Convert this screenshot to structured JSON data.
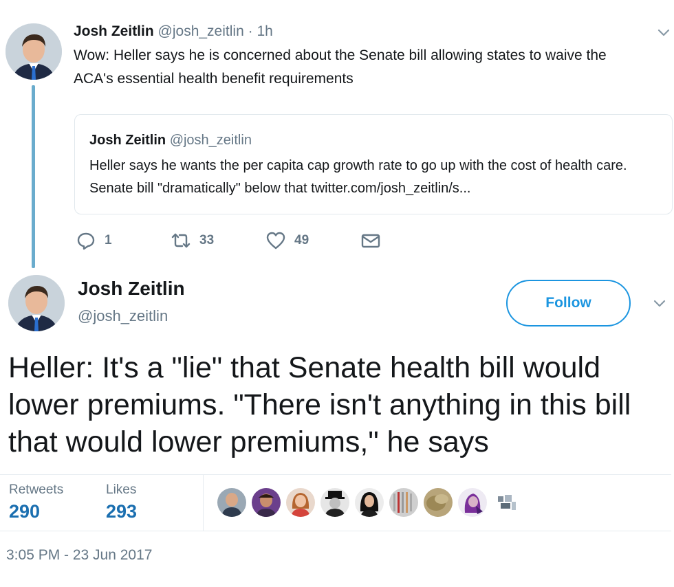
{
  "thread_tweet": {
    "name": "Josh Zeitlin",
    "handle": "@josh_zeitlin",
    "separator": "·",
    "time": "1h",
    "text": "Wow: Heller says he is concerned about the Senate bill allowing states to waive the ACA's essential health benefit requirements",
    "quoted": {
      "name": "Josh Zeitlin",
      "handle": "@josh_zeitlin",
      "text": "Heller says he wants the per capita cap growth rate to go up with the cost of health care. Senate bill \"dramatically\" below that twitter.com/josh_zeitlin/s..."
    },
    "actions": {
      "replies": "1",
      "retweets": "33",
      "likes": "49"
    }
  },
  "main_tweet": {
    "name": "Josh Zeitlin",
    "handle": "@josh_zeitlin",
    "follow_label": "Follow",
    "text": "Heller: It's a \"lie\" that Senate health bill would lower premiums. \"There isn't anything in this bill that would lower premiums,\" he says",
    "stats": {
      "retweets_label": "Retweets",
      "retweets_value": "290",
      "likes_label": "Likes",
      "likes_value": "293"
    },
    "timestamp": "3:05 PM - 23 Jun 2017"
  },
  "icons": {
    "reply": "reply-icon",
    "retweet": "retweet-icon",
    "like": "heart-icon",
    "dm": "envelope-icon",
    "menu": "chevron-down-icon"
  },
  "colors": {
    "link_blue": "#1b95e0",
    "count_blue": "#1b6fb0",
    "muted": "#657786",
    "thread_line": "#6aaccd"
  }
}
